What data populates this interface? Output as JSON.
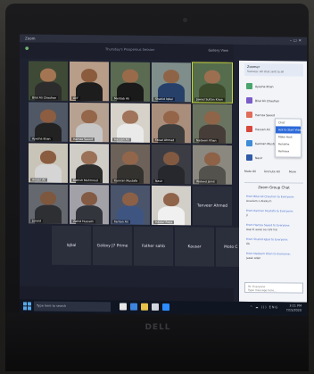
{
  "screen": {
    "window_title": "Zoom",
    "meeting_title": "Thursday's Prosperous Session",
    "view_label": "Gallery View"
  },
  "gallery": {
    "tiles": [
      {
        "name": "Bilal Ali Chauhan",
        "color": "#3e4a36",
        "skin": "#a47553",
        "shirt": "#2c2c2c",
        "kind": "video"
      },
      {
        "name": "Arif",
        "color": "#b89d88",
        "skin": "#8a5b3c",
        "shirt": "#1d1d1d",
        "kind": "video"
      },
      {
        "name": "Mehtab Ali",
        "color": "#5b6b52",
        "skin": "#9a6b4b",
        "shirt": "#1a1a1a",
        "kind": "video"
      },
      {
        "name": "Shahid Iqbal",
        "color": "#7f8e8a",
        "skin": "#8f6446",
        "shirt": "#27406a",
        "kind": "video"
      },
      {
        "name": "Jawad Sultan Khan",
        "color": "#556d4c",
        "skin": "#9c6f50",
        "shirt": "#3d4b2d",
        "kind": "video"
      },
      {
        "name": "Ayesha Khan",
        "color": "#505865",
        "skin": "#8c5d40",
        "shirt": "#222",
        "kind": "video"
      },
      {
        "name": "Hamza Saeed",
        "color": "#b7a292",
        "skin": "#94664a",
        "shirt": "#c7c7c7",
        "kind": "video"
      },
      {
        "name": "Hassan Ali",
        "color": "#d6d2ca",
        "skin": "#a0745a",
        "shirt": "#eaeaea",
        "kind": "video"
      },
      {
        "name": "Faisal Ahmad",
        "color": "#aa8e7c",
        "skin": "#95654a",
        "shirt": "#3c3c3c",
        "kind": "video"
      },
      {
        "name": "Nadeem Khan",
        "color": "#6a7360",
        "skin": "#8e6548",
        "shirt": "#463d38",
        "kind": "video"
      },
      {
        "name": "Anwar Ali",
        "color": "#c9c4b8",
        "skin": "#8a5d41",
        "shirt": "#d5d5d5",
        "kind": "video"
      },
      {
        "name": "Danish Mehmood",
        "color": "#cfcdc6",
        "skin": "#9b7158",
        "shirt": "#2c2c2c",
        "kind": "video"
      },
      {
        "name": "Kamran Mustafa",
        "color": "#6d6259",
        "skin": "#92664b",
        "shirt": "#34322f",
        "kind": "video"
      },
      {
        "name": "Nasir",
        "color": "#3c3d44",
        "skin": "#825a41",
        "shirt": "#27282e",
        "kind": "video"
      },
      {
        "name": "Waleed Jamil",
        "color": "#8b8880",
        "skin": "#8d6247",
        "shirt": "#54524d",
        "kind": "video"
      },
      {
        "name": "Junaid",
        "color": "#65686e",
        "skin": "#7e573f",
        "shirt": "#2d2f33",
        "kind": "video"
      },
      {
        "name": "Zahid Hussain",
        "color": "#a3a1a8",
        "skin": "#835a43",
        "shirt": "#32353c",
        "kind": "video"
      },
      {
        "name": "Farhan Ali",
        "color": "#4a556b",
        "skin": "#8c6047",
        "shirt": "#3f5581",
        "kind": "video"
      },
      {
        "name": "Haider Raza",
        "color": "#d2cfc9",
        "skin": "#90644a",
        "shirt": "#f0f0f0",
        "kind": "video"
      },
      {
        "name": "Tanvir Ahmed",
        "color": "#2b2e3b",
        "kind": "text",
        "center": "Tanveer Ahmed"
      },
      {
        "name": "Iqbal",
        "color": "#2b2e3b",
        "kind": "text",
        "center": "Iqbal"
      },
      {
        "name": "Galaxy J7 Prime",
        "color": "#2b2e3b",
        "kind": "text",
        "center": "Galaxy J7 Prime"
      },
      {
        "name": "Father sahb",
        "color": "#2b2e3b",
        "kind": "text",
        "center": "Father sahb"
      },
      {
        "name": "Kausar",
        "color": "#2b2e3b",
        "kind": "text",
        "center": "Kausar"
      },
      {
        "name": "Moto C Plus",
        "color": "#2b2e3b",
        "kind": "text",
        "center": "Moto C Plus"
      }
    ]
  },
  "side_panel": {
    "notify_name": "Zoomer",
    "notify_text": "Success: All chat sent to all",
    "participants": [
      {
        "name": "Ayesha Khan",
        "color": "#4aa56d"
      },
      {
        "name": "Bilal Ali Chauhan",
        "color": "#7a5cc8"
      },
      {
        "name": "Hamza Saeed",
        "color": "#e06d5a"
      },
      {
        "name": "Hassan Ali",
        "color": "#d8463c"
      },
      {
        "name": "Kamran Mustafa",
        "color": "#3e8bd8"
      },
      {
        "name": "Nasir",
        "color": "#2f5aa6"
      }
    ],
    "context_menu": [
      "Chat",
      "Ask to Start Video",
      "Make Host",
      "Rename",
      "Remove"
    ],
    "context_selected": 1,
    "mute_all": "Mute All",
    "unmute_all": "Unmute All",
    "more": "More",
    "chat_title": "Zoom Group Chat",
    "messages": [
      {
        "who": "From Bilal Ali Chauhan to Everyone:",
        "text": "Assalam o Alaikum"
      },
      {
        "who": "From Kamran Mustafa to Everyone:",
        "text": "Ji"
      },
      {
        "who": "From Hamza Saeed to Everyone:",
        "text": "Aap ki awaz aa rahi hai"
      },
      {
        "who": "From Shahid Iqbal to Everyone:",
        "text": "Ok"
      },
      {
        "who": "From Nadeem Khan to Everyone:",
        "text": "Jazak Allah"
      }
    ],
    "send_to": "To: Everyone",
    "input_placeholder": "Type message here..."
  },
  "taskbar": {
    "search_placeholder": "Type here to search",
    "tray": "^ ☁ ))) ENG",
    "time": "3:11 PM",
    "date": "7/15/2020"
  },
  "brand": "DELL"
}
